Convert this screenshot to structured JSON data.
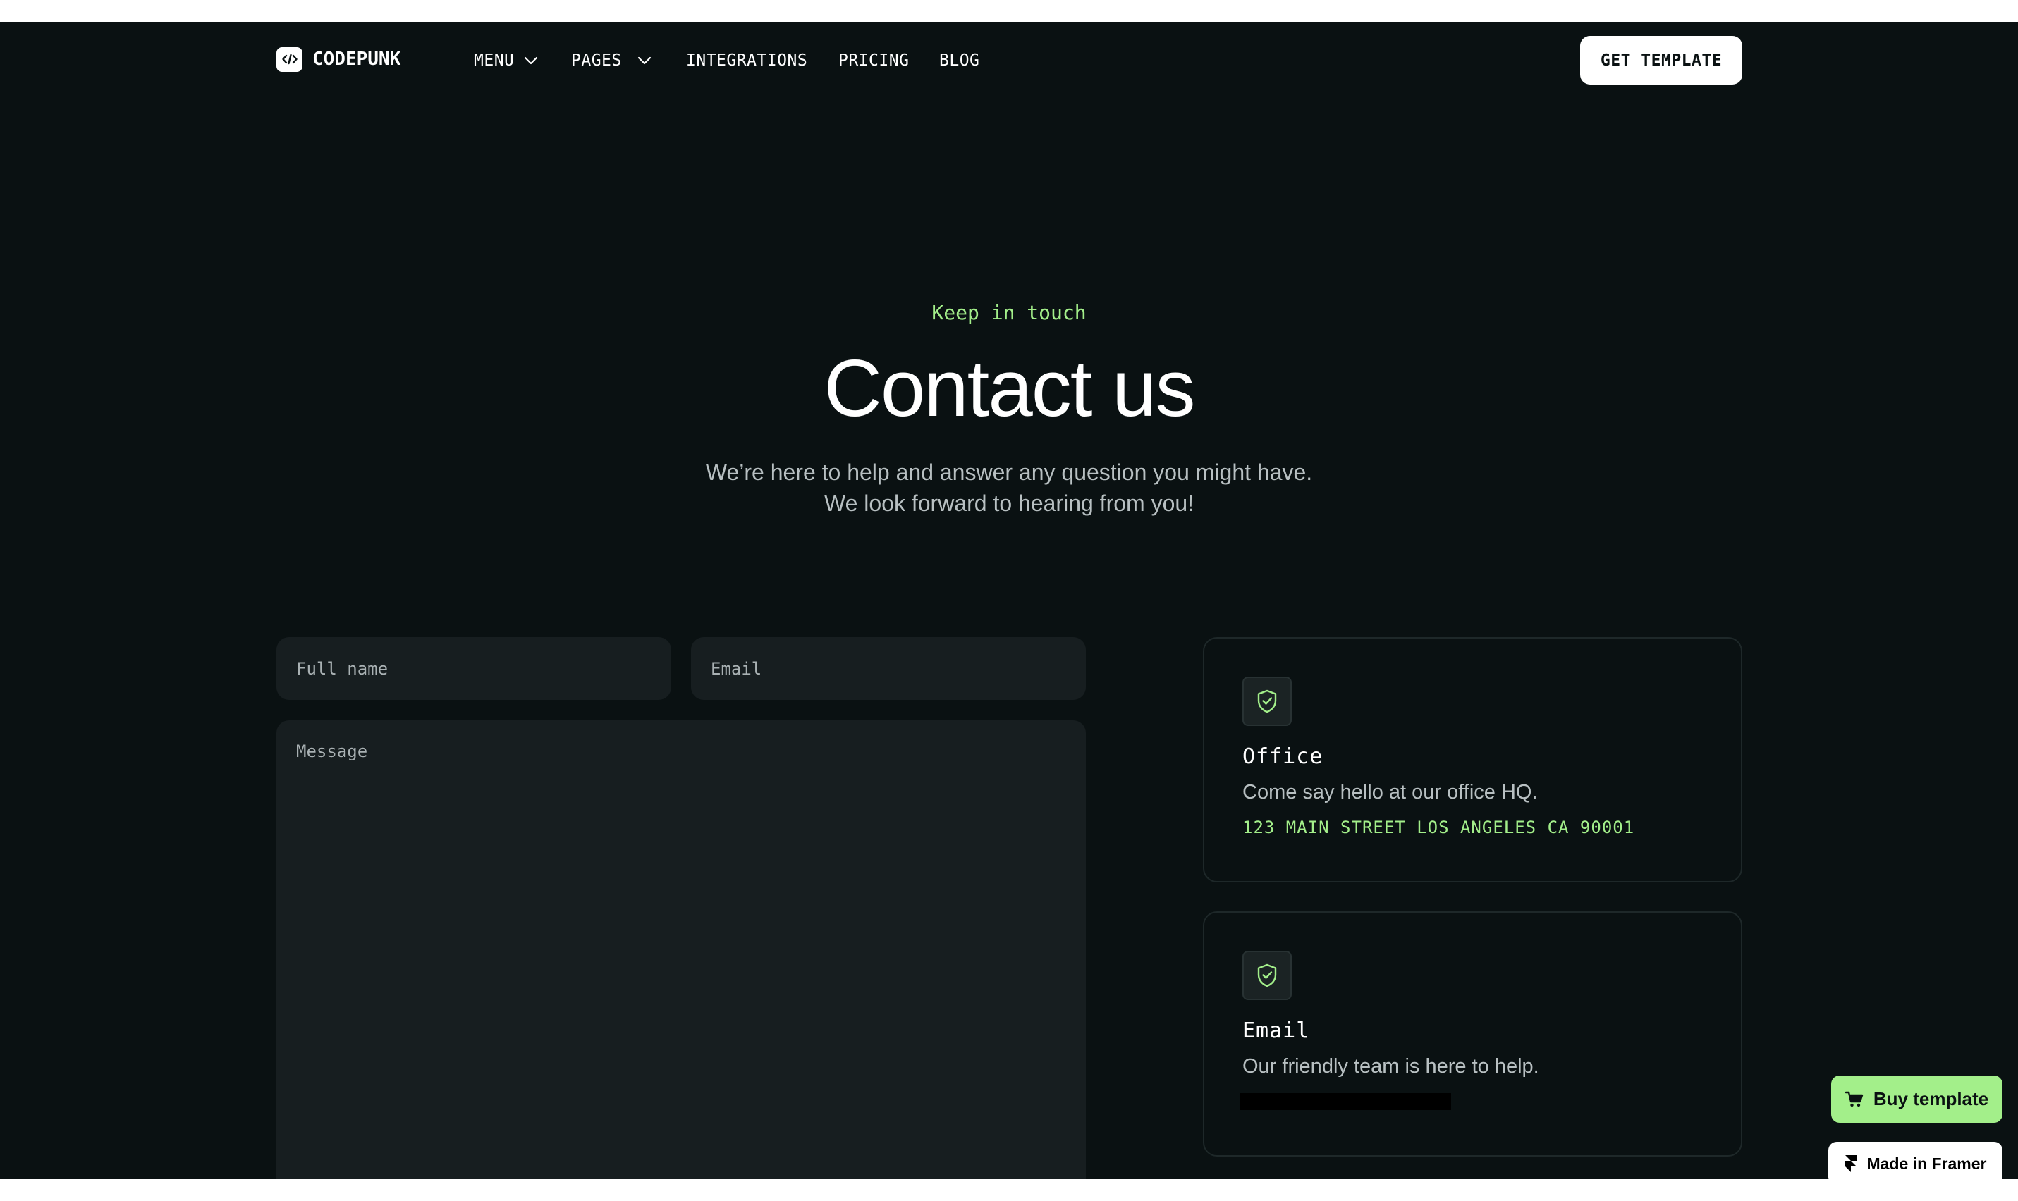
{
  "colors": {
    "background": "#0a1112",
    "accent": "#a3ef8a",
    "field": "#171e20",
    "text": "#ffffff",
    "muted": "#b8c0c2"
  },
  "nav": {
    "brand": "CODEPUNK",
    "items": [
      {
        "label": "MENU",
        "icon": "chevron-down-icon"
      },
      {
        "label": "PAGES",
        "icon": "chevron-down-icon"
      },
      {
        "label": "INTEGRATIONS"
      },
      {
        "label": "PRICING"
      },
      {
        "label": "BLOG"
      }
    ],
    "cta": "GET TEMPLATE"
  },
  "hero": {
    "eyebrow": "Keep in touch",
    "title": "Contact us",
    "subtitle": "We’re here to help and answer any question you might have. We look forward to hearing from you!"
  },
  "form": {
    "name_placeholder": "Full name",
    "email_placeholder": "Email",
    "message_placeholder": "Message"
  },
  "cards": [
    {
      "icon": "shield-check-icon",
      "title": "Office",
      "description": "Come say hello at our office HQ.",
      "link": "123 MAIN STREET LOS ANGELES CA 90001"
    },
    {
      "icon": "shield-check-icon",
      "title": "Email",
      "description": "Our friendly team is here to help."
    }
  ],
  "badges": {
    "buy": "Buy template",
    "framer": "Made in Framer"
  }
}
